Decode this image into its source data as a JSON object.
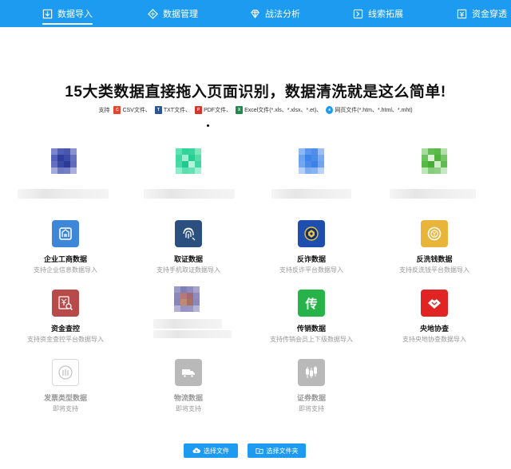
{
  "nav": {
    "items": [
      {
        "label": "数据导入",
        "icon": "upload-icon"
      },
      {
        "label": "数据管理",
        "icon": "diamond-layers-icon"
      },
      {
        "label": "战法分析",
        "icon": "gem-icon"
      },
      {
        "label": "线索拓展",
        "icon": "extend-icon"
      },
      {
        "label": "资金穿透",
        "icon": "fund-icon"
      }
    ]
  },
  "headline": "15大类数据直接拖入页面识别，数据清洗就是这么简单!",
  "support": {
    "prefix": "支持",
    "types": [
      {
        "label": "CSV文件、",
        "badge": "C",
        "color": "#e5442d"
      },
      {
        "label": "TXT文件、",
        "badge": "T",
        "color": "#2b5797"
      },
      {
        "label": "PDF文件、",
        "badge": "P",
        "color": "#d9342b"
      },
      {
        "label": "Excel文件(*.xls、*.xlsx、*.et)、",
        "badge": "X",
        "color": "#1e8a4c"
      },
      {
        "label": "网页文件(*.htm、*.html、*.mht)",
        "badge": "e",
        "color": "#1d9bf0"
      }
    ]
  },
  "cards": [
    {
      "title": "企业工商数据",
      "sub": "支持企业信息数据导入",
      "icon": "building-icon",
      "color": "#3e86d8"
    },
    {
      "title": "取证数据",
      "sub": "支持手机取证数据导入",
      "icon": "fingerprint-icon",
      "color": "#2b4f7e"
    },
    {
      "title": "反诈数据",
      "sub": "支持反诈平台数据导入",
      "icon": "police-badge-icon",
      "color": "#1f4fae"
    },
    {
      "title": "反洗钱数据",
      "sub": "支持反洗钱平台数据导入",
      "icon": "coin-icon",
      "color": "#e9b43a"
    },
    {
      "title": "资金查控",
      "sub": "支持资金查控平台数据导入",
      "icon": "yuan-search-icon",
      "color": "#b94a4a"
    },
    {
      "title": "传销数据",
      "sub": "支持传销会员上下级数据导入",
      "icon": "chuan-icon",
      "color": "#27b34a",
      "glyph": "传"
    },
    {
      "title": "央地协查",
      "sub": "支持央地协查数据导入",
      "icon": "handshake-icon",
      "color": "#e02424"
    },
    {
      "title": "发票类型数据",
      "sub": "即将支持",
      "icon": "invoice-icon",
      "color": "#d0d0d0"
    },
    {
      "title": "物流数据",
      "sub": "即将支持",
      "icon": "truck-icon",
      "color": "#b9b9b9"
    },
    {
      "title": "证券数据",
      "sub": "即将支持",
      "icon": "candlestick-icon",
      "color": "#b9b9b9"
    }
  ],
  "buttons": {
    "select_file": "选择文件",
    "select_folder": "选择文件夹"
  }
}
